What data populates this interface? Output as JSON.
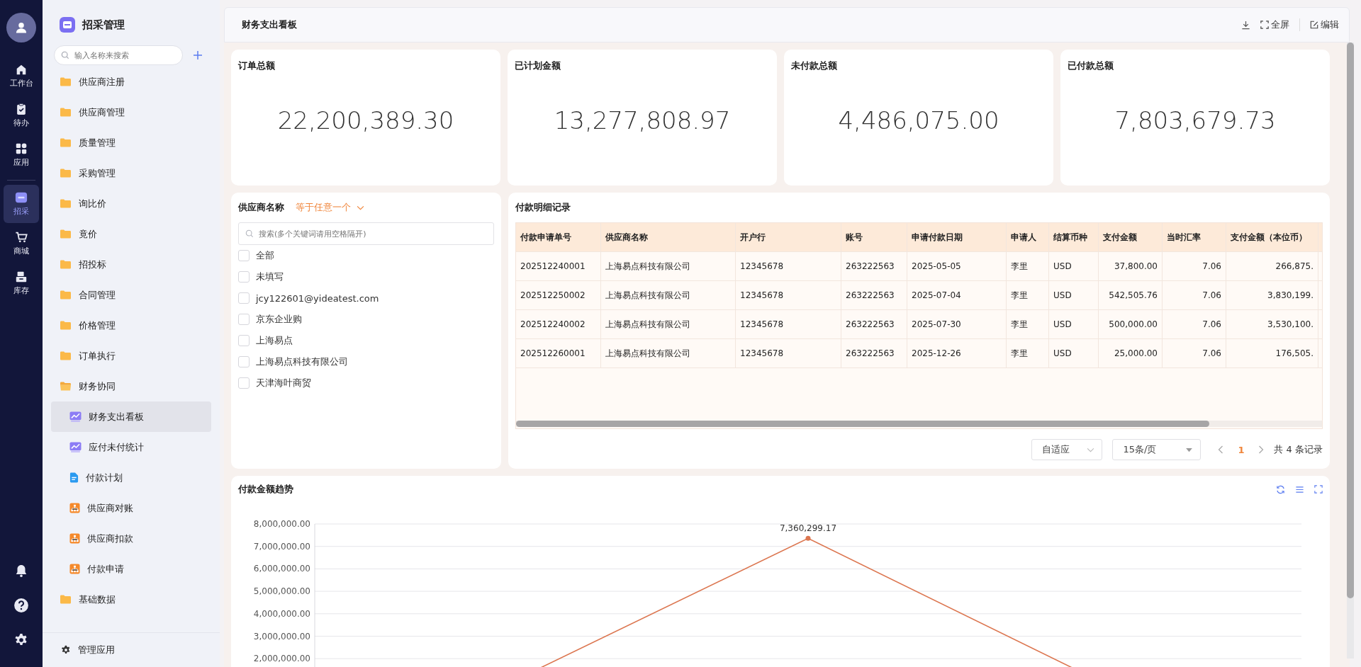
{
  "rail": {
    "items": [
      {
        "label": "工作台",
        "selected": false
      },
      {
        "label": "待办",
        "selected": false
      },
      {
        "label": "应用",
        "selected": false
      },
      {
        "label": "招采",
        "selected": true
      },
      {
        "label": "商城",
        "selected": false
      },
      {
        "label": "库存",
        "selected": false
      }
    ]
  },
  "sidebar": {
    "title": "招采管理",
    "search_placeholder": "输入名称来搜索",
    "items": [
      {
        "label": "供应商注册",
        "expanded": false
      },
      {
        "label": "供应商管理",
        "expanded": false
      },
      {
        "label": "质量管理",
        "expanded": false
      },
      {
        "label": "采购管理",
        "expanded": false
      },
      {
        "label": "询比价",
        "expanded": false
      },
      {
        "label": "竟价",
        "expanded": false
      },
      {
        "label": "招投标",
        "expanded": false
      },
      {
        "label": "合同管理",
        "expanded": false
      },
      {
        "label": "价格管理",
        "expanded": false
      },
      {
        "label": "订单执行",
        "expanded": false
      },
      {
        "label": "财务协同",
        "expanded": true,
        "children": [
          {
            "label": "财务支出看板",
            "kind": "chart",
            "selected": true
          },
          {
            "label": "应付未付统计",
            "kind": "chart",
            "selected": false
          },
          {
            "label": "付款计划",
            "kind": "doc",
            "selected": false
          },
          {
            "label": "供应商对账",
            "kind": "org",
            "selected": false
          },
          {
            "label": "供应商扣款",
            "kind": "org",
            "selected": false
          },
          {
            "label": "付款申请",
            "kind": "org",
            "selected": false
          }
        ]
      },
      {
        "label": "基础数据",
        "expanded": false
      }
    ],
    "footer": "管理应用"
  },
  "header": {
    "title": "财务支出看板",
    "fullscreen": "全屏",
    "edit": "编辑"
  },
  "stats": [
    {
      "label": "订单总额",
      "value": "22,200,389.30"
    },
    {
      "label": "已计划金额",
      "value": "13,277,808.97"
    },
    {
      "label": "未付款总额",
      "value": "4,486,075.00"
    },
    {
      "label": "已付款总额",
      "value": "7,803,679.73"
    }
  ],
  "filter": {
    "label": "供应商名称",
    "operator": "等于任意一个",
    "placeholder": "搜索(多个关键词请用空格隔开)",
    "options": [
      {
        "label": "全部",
        "checked": false
      },
      {
        "label": "未填写",
        "checked": false
      },
      {
        "label": "jcy122601@yideatest.com",
        "checked": false
      },
      {
        "label": "京东企业购",
        "checked": false
      },
      {
        "label": "上海易点",
        "checked": false
      },
      {
        "label": "上海易点科技有限公司",
        "checked": false
      },
      {
        "label": "天津海叶商贸",
        "checked": false
      }
    ]
  },
  "table": {
    "title": "付款明细记录",
    "columns": [
      "付款申请单号",
      "供应商名称",
      "开户行",
      "账号",
      "申请付款日期",
      "申请人",
      "结算币种",
      "支付金额",
      "当时汇率",
      "支付金额（本位币）"
    ],
    "rows": [
      [
        "202512240001",
        "上海易点科技有限公司",
        "12345678",
        "263222563",
        "2025-05-05",
        "李里",
        "USD",
        "37,800.00",
        "7.06",
        "266,875."
      ],
      [
        "202512250002",
        "上海易点科技有限公司",
        "12345678",
        "263222563",
        "2025-07-04",
        "李里",
        "USD",
        "542,505.76",
        "7.06",
        "3,830,199."
      ],
      [
        "202512240002",
        "上海易点科技有限公司",
        "12345678",
        "263222563",
        "2025-07-30",
        "李里",
        "USD",
        "500,000.00",
        "7.06",
        "3,530,100."
      ],
      [
        "202512260001",
        "上海易点科技有限公司",
        "12345678",
        "263222563",
        "2025-12-26",
        "李里",
        "USD",
        "25,000.00",
        "7.06",
        "176,505."
      ]
    ],
    "pagination": {
      "size_mode": "自适应",
      "page_size": "15条/页",
      "pages": [
        {
          "label": "1",
          "selected": true
        }
      ],
      "total": "共 4 条记录"
    }
  },
  "chart": {
    "title": "付款金额趋势",
    "chart_data": {
      "type": "line",
      "grid": true,
      "ylim": [
        0,
        8000000
      ],
      "yticks": [
        {
          "value": 2000000,
          "label": "2,000,000.00"
        },
        {
          "value": 3000000,
          "label": "3,000,000.00"
        },
        {
          "value": 4000000,
          "label": "4,000,000.00"
        },
        {
          "value": 5000000,
          "label": "5,000,000.00"
        },
        {
          "value": 6000000,
          "label": "6,000,000.00"
        },
        {
          "value": 7000000,
          "label": "7,000,000.00"
        },
        {
          "value": 8000000,
          "label": "8,000,000.00"
        }
      ],
      "series": [
        {
          "color": "#dc7650",
          "marker": true,
          "values": [
            270000,
            7360299.17,
            180000
          ]
        }
      ],
      "annotations": [
        {
          "y": 7360299.17,
          "text": "7,360,299.17"
        }
      ]
    }
  }
}
